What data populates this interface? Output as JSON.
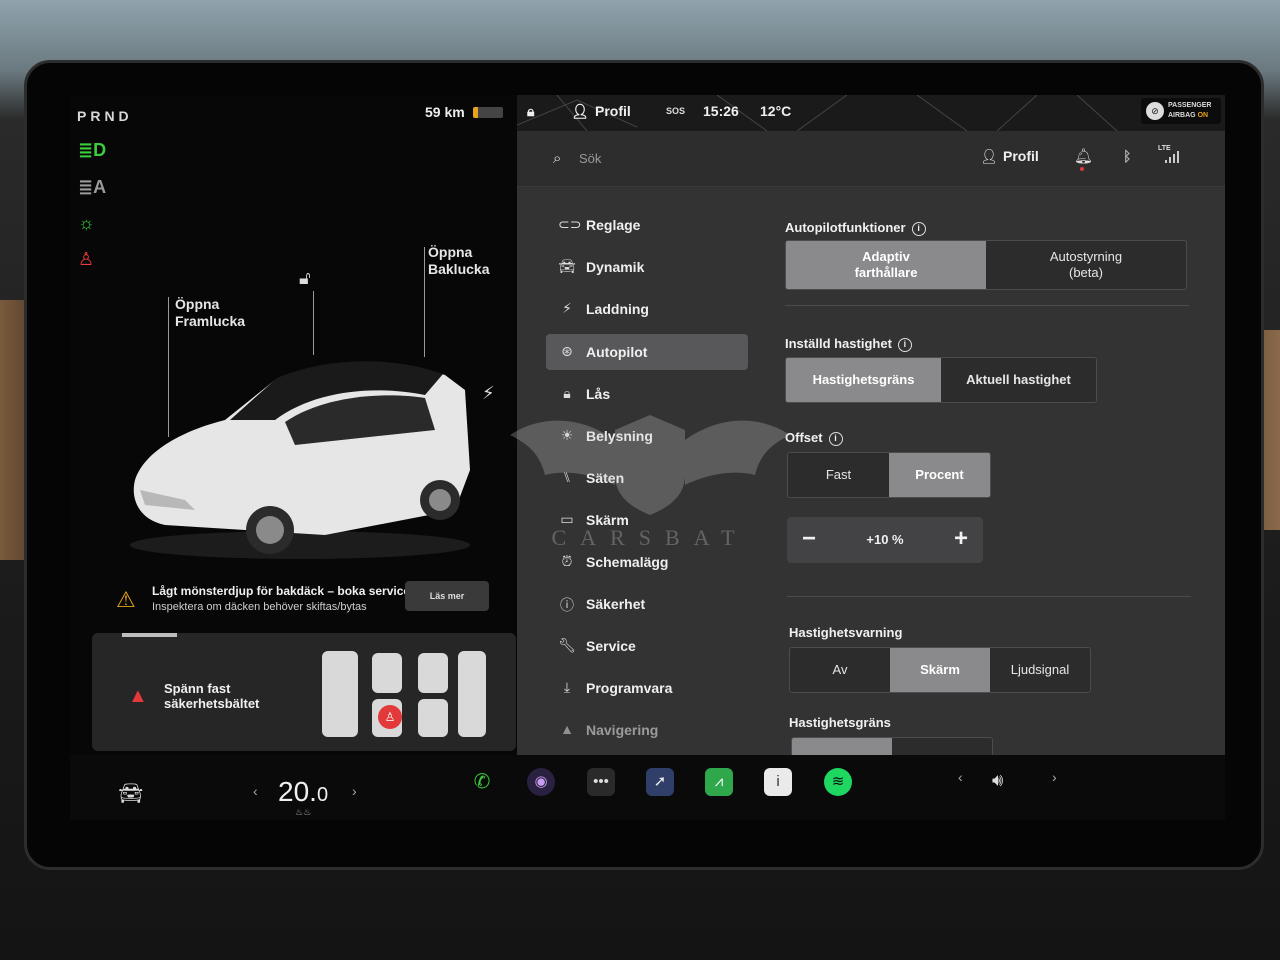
{
  "colors": {
    "accent_green": "#3ccd3c",
    "warning_red": "#e23a3a",
    "warning_amber": "#e8a21c",
    "panel_bg": "#333334",
    "selected_bg": "#8a8a8c"
  },
  "left_panel": {
    "gear": "PRND",
    "range": "59 km",
    "battery_level_percent": 15,
    "telltales": [
      "headlight-on-icon",
      "auto-headlight-icon",
      "parking-light-icon",
      "seatbelt-warning-icon"
    ],
    "callouts": {
      "front": "Öppna\nFramlucka",
      "rear": "Öppna\nBaklucka"
    },
    "tire_alert": {
      "title": "Lågt mönsterdjup för bakdäck – boka service",
      "subtitle": "Inspektera om däcken behöver skiftas/bytas",
      "button": "Läs mer"
    },
    "seatbelt_card": {
      "text": "Spänn fast\nsäkerhetsbältet"
    }
  },
  "status_bar": {
    "profile": "Profil",
    "sos": "SOS",
    "time": "15:26",
    "temperature": "12°C",
    "airbag_line1": "PASSENGER",
    "airbag_line2": "AIRBAG",
    "airbag_state": "ON"
  },
  "header": {
    "search_placeholder": "Sök",
    "profile": "Profil",
    "network": "LTE"
  },
  "nav": {
    "items": [
      {
        "label": "Reglage",
        "icon": "toggle-icon"
      },
      {
        "label": "Dynamik",
        "icon": "car-icon"
      },
      {
        "label": "Laddning",
        "icon": "bolt-icon"
      },
      {
        "label": "Autopilot",
        "icon": "steering-wheel-icon"
      },
      {
        "label": "Lås",
        "icon": "lock-icon"
      },
      {
        "label": "Belysning",
        "icon": "sun-icon"
      },
      {
        "label": "Säten",
        "icon": "seat-icon"
      },
      {
        "label": "Skärm",
        "icon": "display-icon"
      },
      {
        "label": "Schemalägg",
        "icon": "clock-icon"
      },
      {
        "label": "Säkerhet",
        "icon": "alert-circle-icon"
      },
      {
        "label": "Service",
        "icon": "wrench-icon"
      },
      {
        "label": "Programvara",
        "icon": "download-icon"
      },
      {
        "label": "Navigering",
        "icon": "navigation-icon"
      }
    ],
    "active": "Autopilot"
  },
  "autopilot": {
    "functions": {
      "title": "Autopilotfunktioner",
      "options": [
        "Adaptiv\nfarthållare",
        "Autostyrning\n(beta)"
      ],
      "selected": "Adaptiv\nfarthållare"
    },
    "set_speed": {
      "title": "Inställd hastighet",
      "options": [
        "Hastighetsgräns",
        "Aktuell hastighet"
      ],
      "selected": "Hastighetsgräns"
    },
    "offset": {
      "title": "Offset",
      "options": [
        "Fast",
        "Procent"
      ],
      "selected": "Procent",
      "value": "+10 %",
      "minus": "−",
      "plus": "+"
    },
    "speed_warning": {
      "title": "Hastighetsvarning",
      "options": [
        "Av",
        "Skärm",
        "Ljudsignal"
      ],
      "selected": "Skärm"
    },
    "speed_limit": {
      "title": "Hastighetsgräns"
    }
  },
  "bottom_bar": {
    "temperature_whole": "20.",
    "temperature_decimal": "0",
    "apps": [
      "phone-icon",
      "camera-icon",
      "more-icon",
      "navigation-app-icon",
      "energy-app-icon",
      "manual-app-icon",
      "spotify-icon"
    ],
    "volume_icon": "volume-icon"
  },
  "watermark": {
    "text": "CARSBAT"
  }
}
